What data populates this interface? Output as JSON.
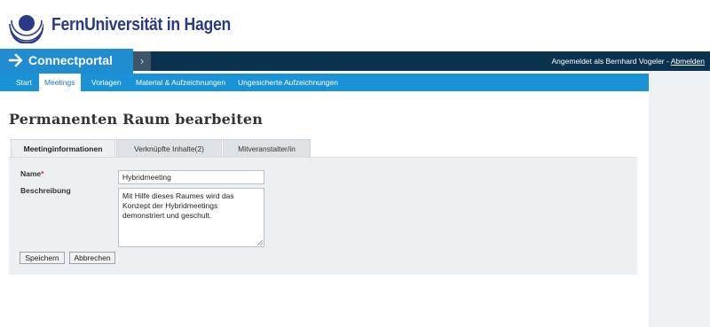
{
  "header": {
    "logo_text": "FernUniversität in Hagen"
  },
  "brandbar": {
    "title": "Connectportal",
    "user_prefix": "Angemeldet als Bernhard Vogeler - ",
    "logout_label": "Abmelden"
  },
  "nav": {
    "items": [
      "Start",
      "Meetings",
      "Vorlagen",
      "Material & Aufzeichnungen",
      "Ungesicherte Aufzeichnungen"
    ],
    "active": "Meetings"
  },
  "page": {
    "title": "Permanenten Raum bearbeiten"
  },
  "tabs": [
    {
      "label": "Meetinginformationen",
      "active": true
    },
    {
      "label": "Verknüpfte Inhalte(2)",
      "active": false
    },
    {
      "label": "Mitveranstalter/in",
      "active": false
    }
  ],
  "form": {
    "name_label": "Name",
    "required_mark": "*",
    "name_value": "Hybridmeeting",
    "description_label": "Beschreibung",
    "description_value": "Mit Hilfe dieses Raumes wird das Konzept der Hybridmeetings demonstriert und geschult.",
    "save_label": "Speichern",
    "cancel_label": "Abbrechen"
  },
  "colors": {
    "brand_blue": "#1f8dd0",
    "topbar": "#0a3350",
    "nav": "#1a93d6",
    "logo": "#2a3a86"
  }
}
